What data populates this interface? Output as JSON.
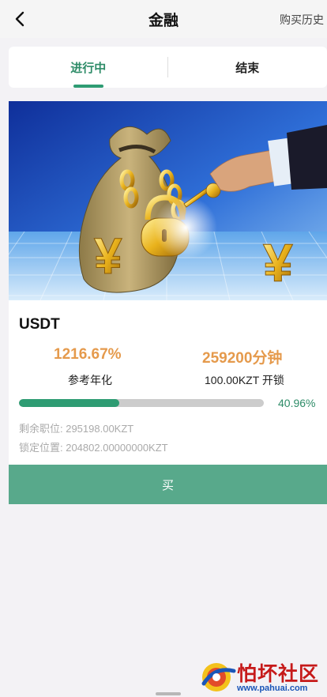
{
  "header": {
    "title": "金融",
    "history_link": "购买历史"
  },
  "tabs": [
    {
      "label": "进行中",
      "active": true
    },
    {
      "label": "结束",
      "active": false
    }
  ],
  "product": {
    "name": "USDT",
    "annual_rate": "1216.67%",
    "annual_rate_label": "参考年化",
    "duration": "259200分钟",
    "min_amount": "100.00KZT 开锁",
    "progress_percent": 40.96,
    "progress_text": "40.96%",
    "remaining_label": "剩余职位: 295198.00KZT",
    "locked_label": "锁定位置: 204802.00000000KZT",
    "buy_label": "买"
  },
  "watermark": {
    "name": "怕坏社区",
    "url": "www.pahuai.com"
  },
  "colors": {
    "accent_green": "#2e9c73",
    "orange": "#e59a4c",
    "buy_button": "#58a98b"
  }
}
